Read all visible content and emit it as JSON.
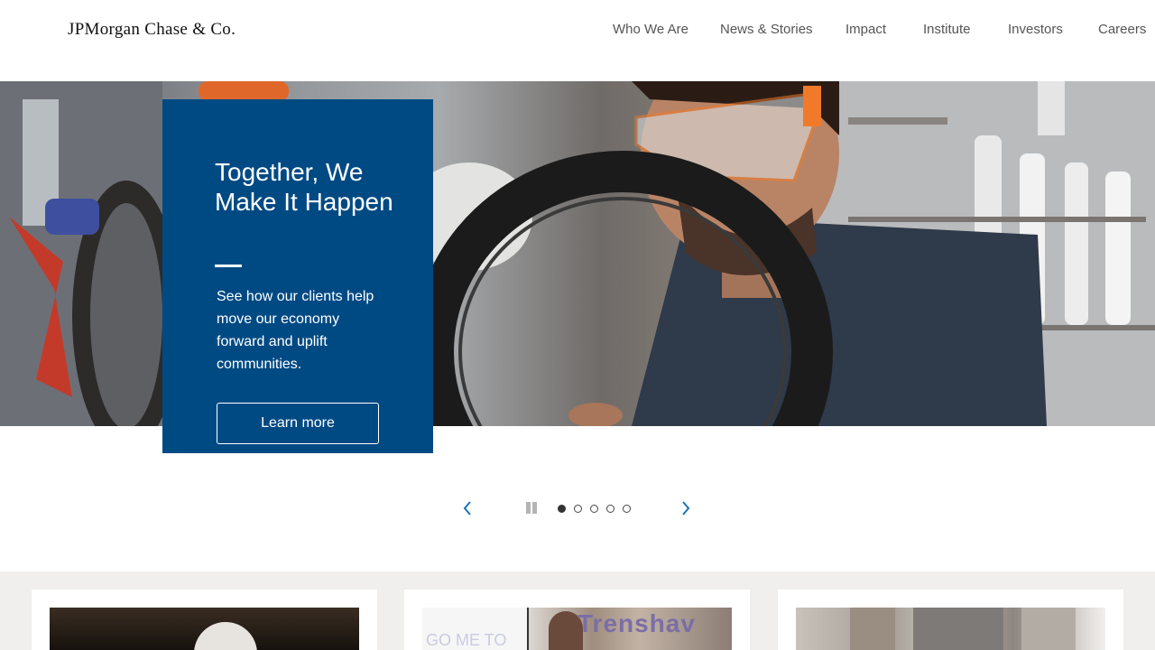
{
  "header": {
    "logo_text": "JPMorgan Chase & Co.",
    "nav": [
      "Who We Are",
      "News & Stories",
      "Impact",
      "Institute",
      "Investors",
      "Careers"
    ]
  },
  "hero": {
    "title": "Together, We Make It Happen",
    "description": "See how our clients help move our economy forward and uplift communities.",
    "button_label": "Learn more"
  },
  "carousel": {
    "slide_count": 5,
    "active_slide": 1
  },
  "cards": {
    "card2_sign_text": "Trenshav",
    "card2_screen_text": "GO ME TO"
  },
  "colors": {
    "promo_background": "#004a84",
    "arrow_color": "#1a73b5",
    "band_background": "#f0efee"
  }
}
